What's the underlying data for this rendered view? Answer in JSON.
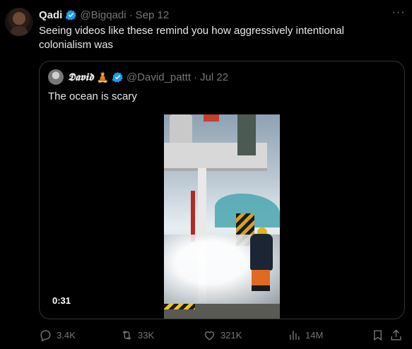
{
  "tweet": {
    "author_name": "Qadi",
    "author_handle": "@Bigqadi",
    "separator": "·",
    "date": "Sep 12",
    "more_label": "···",
    "text": "Seeing videos like these remind you how aggressively intentional colonialism was"
  },
  "quote": {
    "author_name": "𝕯𝖆𝖛𝖎𝖉",
    "author_emoji": "🧘",
    "author_handle": "@David_pattt",
    "separator": "·",
    "date": "Jul 22",
    "text": "The ocean is scary",
    "video_duration": "0:31"
  },
  "actions": {
    "replies": "3.4K",
    "reposts": "33K",
    "likes": "321K",
    "views": "14M"
  },
  "colors": {
    "background": "#000000",
    "text": "#e7e9ea",
    "muted": "#71767b",
    "border": "#2f3336",
    "verified": "#1d9bf0"
  }
}
